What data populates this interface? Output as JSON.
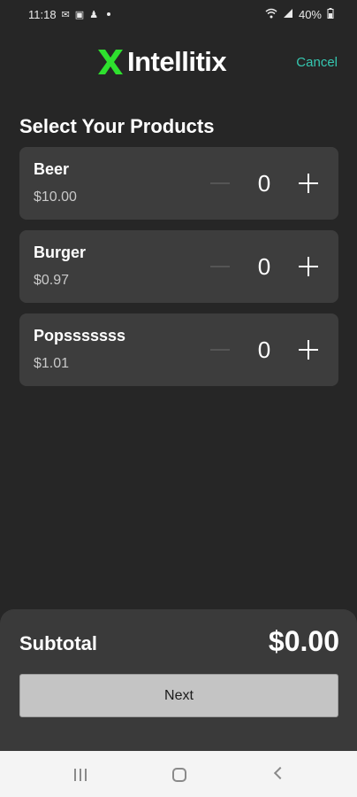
{
  "status_bar": {
    "time": "11:18",
    "battery": "40%"
  },
  "header": {
    "logo_text": "Intellitix",
    "cancel_label": "Cancel"
  },
  "page": {
    "title": "Select Your Products"
  },
  "products": [
    {
      "name": "Beer",
      "price": "$10.00",
      "quantity": "0"
    },
    {
      "name": "Burger",
      "price": "$0.97",
      "quantity": "0"
    },
    {
      "name": "Popsssssss",
      "price": "$1.01",
      "quantity": "0"
    }
  ],
  "summary": {
    "subtotal_label": "Subtotal",
    "subtotal_value": "$0.00",
    "next_label": "Next"
  },
  "colors": {
    "background": "#262626",
    "card": "#3d3d3d",
    "accent_teal": "#35c7b0",
    "logo_green": "#2ee02e"
  }
}
